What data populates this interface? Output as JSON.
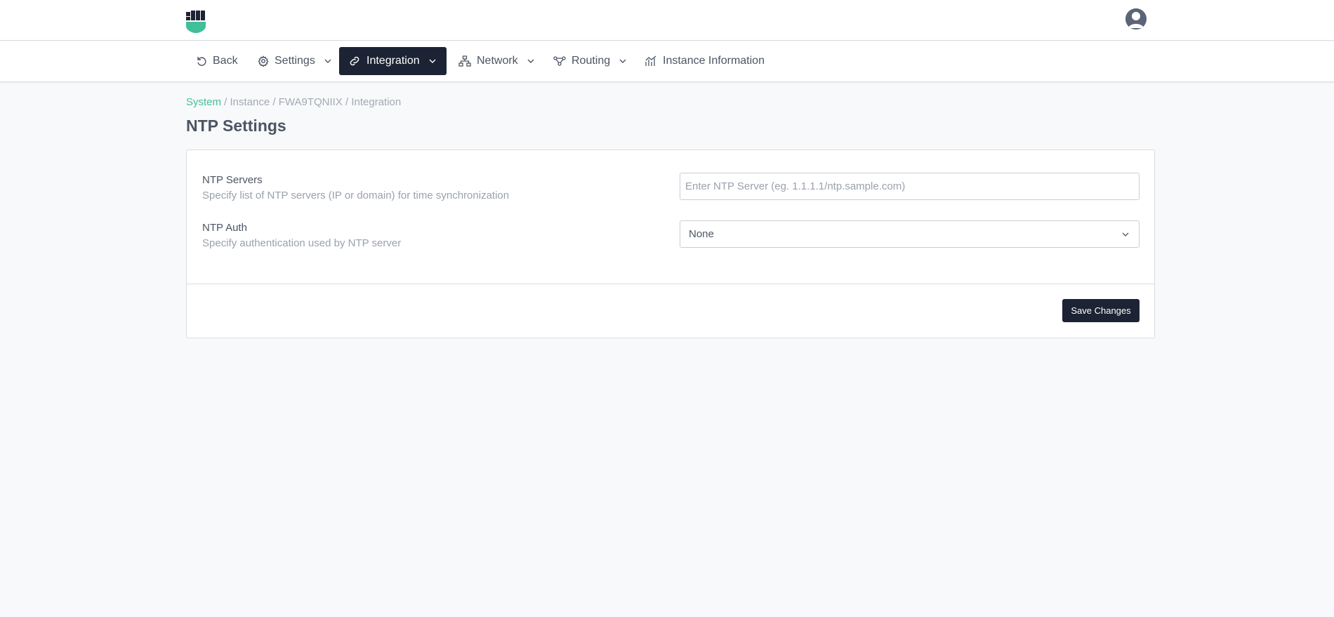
{
  "header": {
    "logo_icon": "shield-logo-icon",
    "avatar_icon": "user-avatar-icon"
  },
  "nav": {
    "back": {
      "label": "Back",
      "icon": "undo-icon"
    },
    "settings": {
      "label": "Settings",
      "icon": "gear-icon"
    },
    "integration": {
      "label": "Integration",
      "icon": "link-icon"
    },
    "network": {
      "label": "Network",
      "icon": "network-icon"
    },
    "routing": {
      "label": "Routing",
      "icon": "routing-icon"
    },
    "instance_info": {
      "label": "Instance Information",
      "icon": "chart-icon"
    }
  },
  "breadcrumb": {
    "root": "System",
    "rest": " / Instance / FWA9TQNIIX / Integration"
  },
  "page": {
    "title": "NTP Settings"
  },
  "form": {
    "ntp_servers": {
      "label": "NTP Servers",
      "help": "Specify list of NTP servers (IP or domain) for time synchronization",
      "value": "",
      "placeholder": "Enter NTP Server (eg. 1.1.1.1/ntp.sample.com)"
    },
    "ntp_auth": {
      "label": "NTP Auth",
      "help": "Specify authentication used by NTP server",
      "selected": "None"
    },
    "save_label": "Save Changes"
  },
  "colors": {
    "accent": "#3fbf9a",
    "dark": "#1c2334",
    "background": "#f8f9fa"
  }
}
